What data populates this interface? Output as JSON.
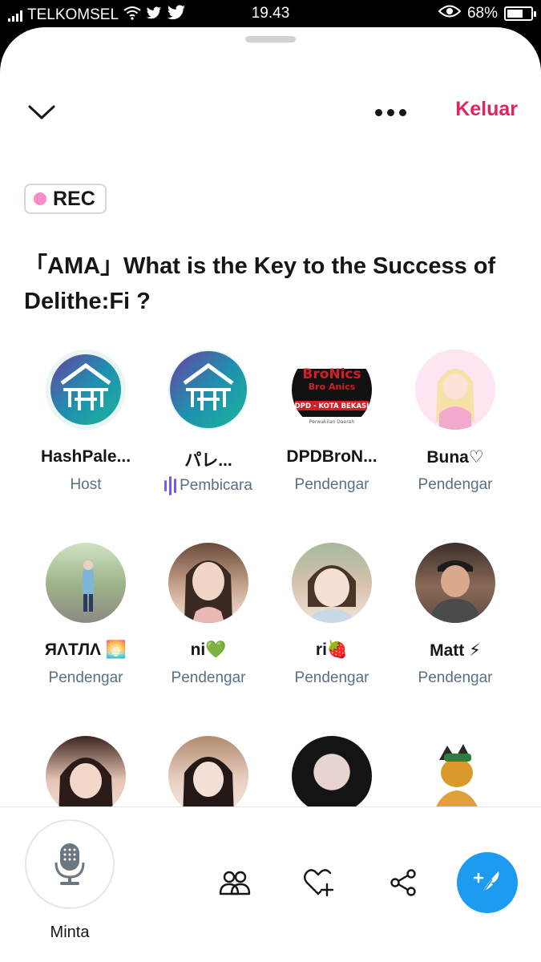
{
  "status_bar": {
    "carrier": "TELKOMSEL",
    "time": "19.43",
    "battery_percent": "68%",
    "battery_level": 0.68
  },
  "header": {
    "leave_label": "Keluar"
  },
  "rec_label": "REC",
  "space_title": "「AMA」What is the Key to the Success of Delithe:Fi ?",
  "participants": [
    {
      "name": "HashPale...",
      "role": "Host"
    },
    {
      "name": "パレ...",
      "role": "Pembicara"
    },
    {
      "name": "DPDBroN...",
      "role": "Pendengar"
    },
    {
      "name": "Buna♡",
      "role": "Pendengar"
    },
    {
      "name": "ЯΛТЛΛ 🌅",
      "role": "Pendengar"
    },
    {
      "name": "ni💚",
      "role": "Pendengar"
    },
    {
      "name": "ri🍓",
      "role": "Pendengar"
    },
    {
      "name": "Matt ⚡",
      "role": "Pendengar"
    },
    {
      "name": "",
      "role": ""
    },
    {
      "name": "",
      "role": ""
    },
    {
      "name": "",
      "role": ""
    },
    {
      "name": "",
      "role": ""
    }
  ],
  "avatar_text": {
    "bronics_line1": "BroNics",
    "bronics_line2": "Bro Anics",
    "bronics_line3": "DPD - KOTA BEKASI",
    "bronics_line4": "Perwakilan Daerah"
  },
  "bottom_bar": {
    "mic_label": "Minta"
  },
  "colors": {
    "leave": "#e0245e",
    "rec_dot": "#f48fc7",
    "speaking": "#7856ff",
    "compose": "#1d9bf0"
  }
}
